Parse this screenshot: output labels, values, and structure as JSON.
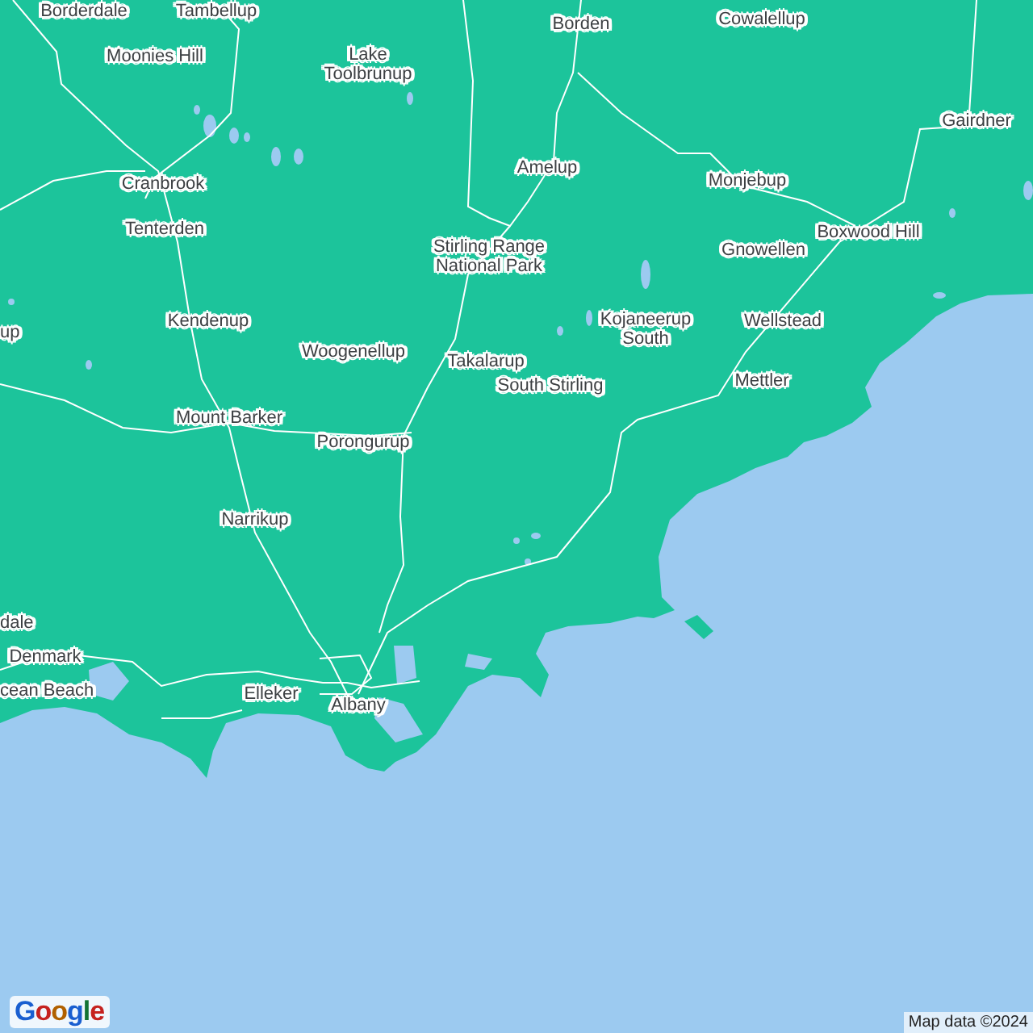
{
  "map": {
    "labels": [
      {
        "text": "Borderdale"
      },
      {
        "text": "Tambellup"
      },
      {
        "text": "Moonies Hill"
      },
      {
        "text": "Lake\nToolbrunup"
      },
      {
        "text": "Borden"
      },
      {
        "text": "Cowalellup"
      },
      {
        "text": "Gairdner"
      },
      {
        "text": "Amelup"
      },
      {
        "text": "Monjebup"
      },
      {
        "text": "Cranbrook"
      },
      {
        "text": "Tenterden"
      },
      {
        "text": "Stirling Range\nNational Park"
      },
      {
        "text": "Boxwood Hill"
      },
      {
        "text": "Gnowellen"
      },
      {
        "text": "Kojaneerup\nSouth"
      },
      {
        "text": "Wellstead"
      },
      {
        "text": "up"
      },
      {
        "text": "Kendenup"
      },
      {
        "text": "Woogenellup"
      },
      {
        "text": "Takalarup"
      },
      {
        "text": "South Stirling"
      },
      {
        "text": "Mettler"
      },
      {
        "text": "Mount Barker"
      },
      {
        "text": "Porongurup"
      },
      {
        "text": "Narrikup"
      },
      {
        "text": "dale"
      },
      {
        "text": "Denmark"
      },
      {
        "text": "cean Beach"
      },
      {
        "text": "Elleker"
      },
      {
        "text": "Albany"
      }
    ]
  },
  "logo": "Google",
  "attribution": "Map data ©2024"
}
